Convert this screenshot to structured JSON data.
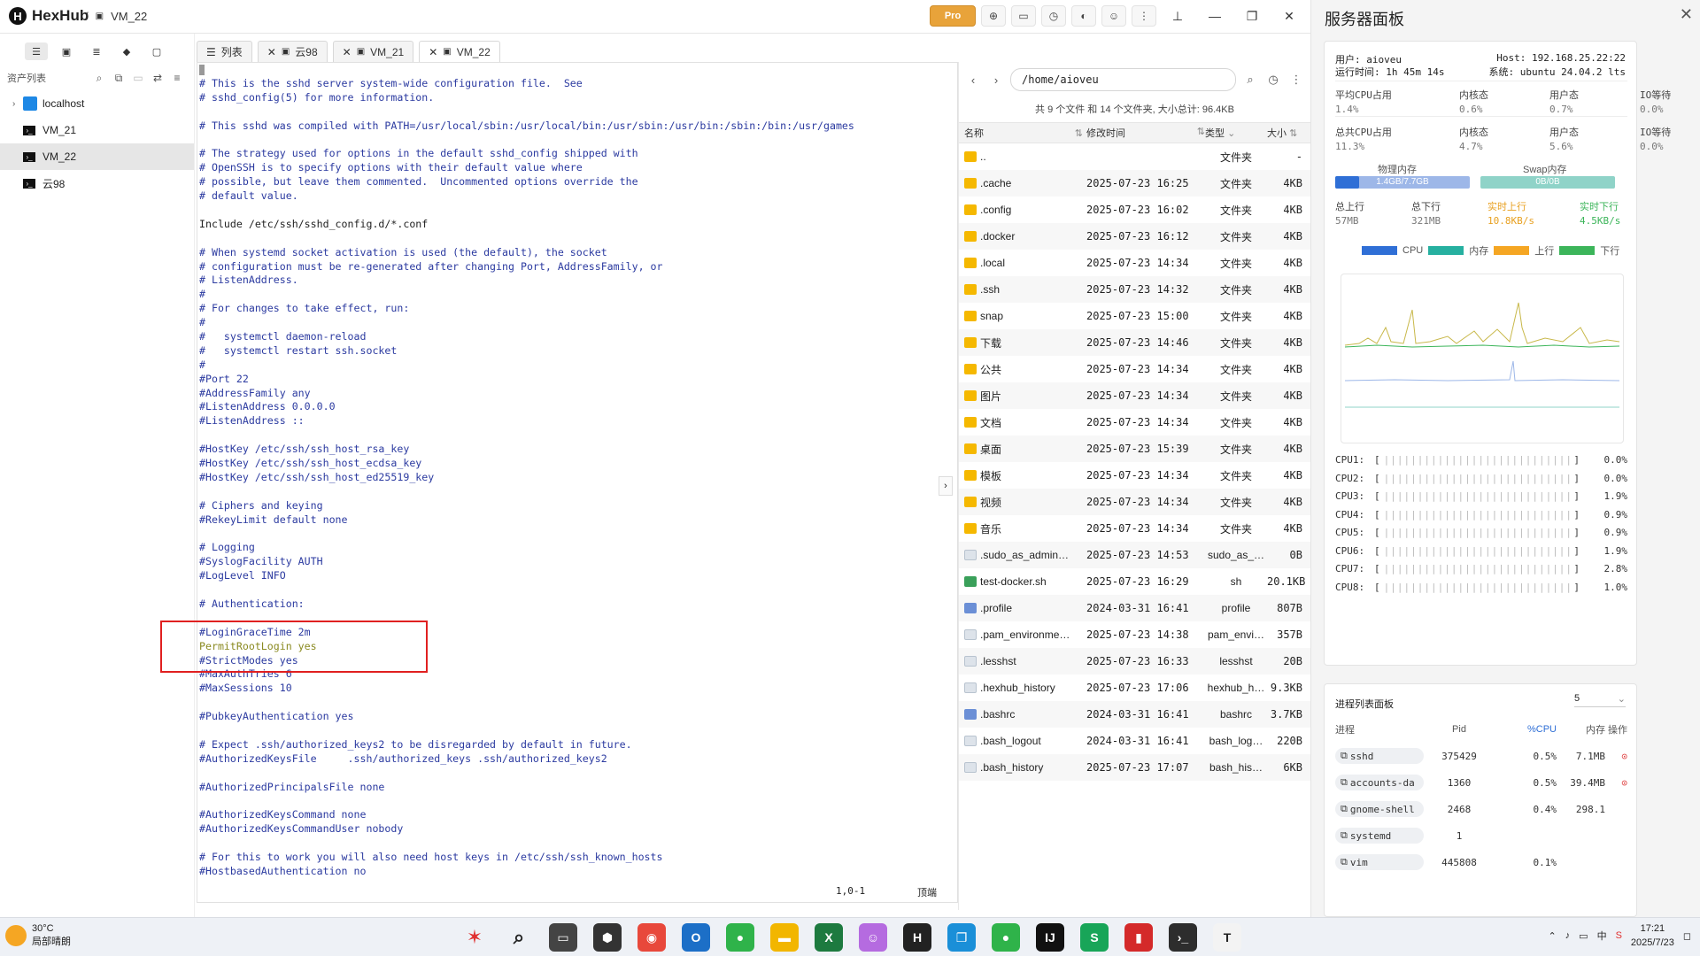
{
  "app": {
    "name": "HexHub",
    "breadcrumb_sep": "/",
    "current": "VM_22",
    "pro_label": "Pro"
  },
  "sidebar": {
    "assets_label": "资产列表",
    "items": [
      {
        "label": "localhost"
      },
      {
        "label": "VM_21"
      },
      {
        "label": "VM_22"
      },
      {
        "label": "云98"
      }
    ]
  },
  "tabs": [
    {
      "label": "列表"
    },
    {
      "label": "云98"
    },
    {
      "label": "VM_21"
    },
    {
      "label": "VM_22"
    }
  ],
  "editor": {
    "lines": [
      "# This is the sshd server system-wide configuration file.  See",
      "# sshd_config(5) for more information.",
      "",
      "# This sshd was compiled with PATH=/usr/local/sbin:/usr/local/bin:/usr/sbin:/usr/bin:/sbin:/bin:/usr/games",
      "",
      "# The strategy used for options in the default sshd_config shipped with",
      "# OpenSSH is to specify options with their default value where",
      "# possible, but leave them commented.  Uncommented options override the",
      "# default value.",
      "",
      "Include /etc/ssh/sshd_config.d/*.conf",
      "",
      "# When systemd socket activation is used (the default), the socket",
      "# configuration must be re-generated after changing Port, AddressFamily, or",
      "# ListenAddress.",
      "#",
      "# For changes to take effect, run:",
      "#",
      "#   systemctl daemon-reload",
      "#   systemctl restart ssh.socket",
      "#",
      "#Port 22",
      "#AddressFamily any",
      "#ListenAddress 0.0.0.0",
      "#ListenAddress ::",
      "",
      "#HostKey /etc/ssh/ssh_host_rsa_key",
      "#HostKey /etc/ssh/ssh_host_ecdsa_key",
      "#HostKey /etc/ssh/ssh_host_ed25519_key",
      "",
      "# Ciphers and keying",
      "#RekeyLimit default none",
      "",
      "# Logging",
      "#SyslogFacility AUTH",
      "#LogLevel INFO",
      "",
      "# Authentication:",
      "",
      "#LoginGraceTime 2m",
      "PermitRootLogin yes",
      "#StrictModes yes",
      "#MaxAuthTries 6",
      "#MaxSessions 10",
      "",
      "#PubkeyAuthentication yes",
      "",
      "# Expect .ssh/authorized_keys2 to be disregarded by default in future.",
      "#AuthorizedKeysFile     .ssh/authorized_keys .ssh/authorized_keys2",
      "",
      "#AuthorizedPrincipalsFile none",
      "",
      "#AuthorizedKeysCommand none",
      "#AuthorizedKeysCommandUser nobody",
      "",
      "# For this to work you will also need host keys in /etc/ssh/ssh_known_hosts",
      "#HostbasedAuthentication no"
    ],
    "cursor": "1,0-1",
    "position": "顶端"
  },
  "files": {
    "path": "/home/aioveu",
    "summary": "共 9 个文件 和 14 个文件夹, 大小总计: 96.4KB",
    "headers": {
      "name": "名称",
      "time": "修改时间",
      "type": "类型",
      "size": "大小"
    },
    "rows": [
      {
        "name": "..",
        "time": "",
        "type": "文件夹",
        "size": "-",
        "kind": "folder"
      },
      {
        "name": ".cache",
        "time": "2025-07-23 16:25",
        "type": "文件夹",
        "size": "4KB",
        "kind": "folder"
      },
      {
        "name": ".config",
        "time": "2025-07-23 16:02",
        "type": "文件夹",
        "size": "4KB",
        "kind": "folder"
      },
      {
        "name": ".docker",
        "time": "2025-07-23 16:12",
        "type": "文件夹",
        "size": "4KB",
        "kind": "folder"
      },
      {
        "name": ".local",
        "time": "2025-07-23 14:34",
        "type": "文件夹",
        "size": "4KB",
        "kind": "folder"
      },
      {
        "name": ".ssh",
        "time": "2025-07-23 14:32",
        "type": "文件夹",
        "size": "4KB",
        "kind": "folder"
      },
      {
        "name": "snap",
        "time": "2025-07-23 15:00",
        "type": "文件夹",
        "size": "4KB",
        "kind": "folder"
      },
      {
        "name": "下载",
        "time": "2025-07-23 14:46",
        "type": "文件夹",
        "size": "4KB",
        "kind": "folder"
      },
      {
        "name": "公共",
        "time": "2025-07-23 14:34",
        "type": "文件夹",
        "size": "4KB",
        "kind": "folder"
      },
      {
        "name": "图片",
        "time": "2025-07-23 14:34",
        "type": "文件夹",
        "size": "4KB",
        "kind": "folder"
      },
      {
        "name": "文档",
        "time": "2025-07-23 14:34",
        "type": "文件夹",
        "size": "4KB",
        "kind": "folder"
      },
      {
        "name": "桌面",
        "time": "2025-07-23 15:39",
        "type": "文件夹",
        "size": "4KB",
        "kind": "folder"
      },
      {
        "name": "模板",
        "time": "2025-07-23 14:34",
        "type": "文件夹",
        "size": "4KB",
        "kind": "folder"
      },
      {
        "name": "视频",
        "time": "2025-07-23 14:34",
        "type": "文件夹",
        "size": "4KB",
        "kind": "folder"
      },
      {
        "name": "音乐",
        "time": "2025-07-23 14:34",
        "type": "文件夹",
        "size": "4KB",
        "kind": "folder"
      },
      {
        "name": ".sudo_as_admin…",
        "time": "2025-07-23 14:53",
        "type": "sudo_as_…",
        "size": "0B",
        "kind": "file"
      },
      {
        "name": "test-docker.sh",
        "time": "2025-07-23 16:29",
        "type": "sh",
        "size": "20.1KB",
        "kind": "sh"
      },
      {
        "name": ".profile",
        "time": "2024-03-31 16:41",
        "type": "profile",
        "size": "807B",
        "kind": "cfg"
      },
      {
        "name": ".pam_environme…",
        "time": "2025-07-23 14:38",
        "type": "pam_envi…",
        "size": "357B",
        "kind": "file"
      },
      {
        "name": ".lesshst",
        "time": "2025-07-23 16:33",
        "type": "lesshst",
        "size": "20B",
        "kind": "file"
      },
      {
        "name": ".hexhub_history",
        "time": "2025-07-23 17:06",
        "type": "hexhub_h…",
        "size": "9.3KB",
        "kind": "file"
      },
      {
        "name": ".bashrc",
        "time": "2024-03-31 16:41",
        "type": "bashrc",
        "size": "3.7KB",
        "kind": "cfg"
      },
      {
        "name": ".bash_logout",
        "time": "2024-03-31 16:41",
        "type": "bash_log…",
        "size": "220B",
        "kind": "file"
      },
      {
        "name": ".bash_history",
        "time": "2025-07-23 17:07",
        "type": "bash_his…",
        "size": "6KB",
        "kind": "file"
      }
    ]
  },
  "panel": {
    "title": "服务器面板",
    "user": "用户: aioveu",
    "host": "Host: 192.168.25.22:22",
    "uptime": "运行时间: 1h 45m 14s",
    "system": "系统: ubuntu 24.04.2 lts",
    "cpu_avg": {
      "labels": [
        "平均CPU占用",
        "内核态",
        "用户态",
        "IO等待"
      ],
      "values": [
        "1.4%",
        "0.6%",
        "0.7%",
        "0.0%"
      ]
    },
    "cpu_total": {
      "labels": [
        "总共CPU占用",
        "内核态",
        "用户态",
        "IO等待"
      ],
      "values": [
        "11.3%",
        "4.7%",
        "5.6%",
        "0.0%"
      ]
    },
    "mem_label": "物理内存",
    "mem_value": "1.4GB/7.7GB",
    "mem_fraction": 0.18,
    "swap_label": "Swap内存",
    "swap_value": "0B/0B",
    "net": {
      "labels": [
        "总上行",
        "总下行",
        "实时上行",
        "实时下行"
      ],
      "values": [
        "57MB",
        "321MB",
        "10.8KB/s",
        "4.5KB/s"
      ]
    },
    "legend": [
      {
        "label": "CPU",
        "color": "#2f6fd6"
      },
      {
        "label": "内存",
        "color": "#26b0a0"
      },
      {
        "label": "上行",
        "color": "#f5a623"
      },
      {
        "label": "下行",
        "color": "#3cb55a"
      }
    ],
    "cpus": [
      {
        "label": "CPU1:",
        "value": "0.0%"
      },
      {
        "label": "CPU2:",
        "value": "0.0%"
      },
      {
        "label": "CPU3:",
        "value": "1.9%"
      },
      {
        "label": "CPU4:",
        "value": "0.9%"
      },
      {
        "label": "CPU5:",
        "value": "0.9%"
      },
      {
        "label": "CPU6:",
        "value": "1.9%"
      },
      {
        "label": "CPU7:",
        "value": "2.8%"
      },
      {
        "label": "CPU8:",
        "value": "1.0%"
      }
    ],
    "proc_title": "进程列表面板",
    "proc_count": "5",
    "proc_headers": {
      "name": "进程",
      "pid": "Pid",
      "cpu": "%CPU",
      "mem": "内存",
      "op": "操作"
    },
    "procs": [
      {
        "name": "sshd",
        "pid": "375429",
        "cpu": "0.5%",
        "mem": "7.1MB"
      },
      {
        "name": "accounts-da",
        "pid": "1360",
        "cpu": "0.5%",
        "mem": "39.4MB"
      },
      {
        "name": "gnome-shell",
        "pid": "2468",
        "cpu": "0.4%",
        "mem": "298.1"
      },
      {
        "name": "systemd",
        "pid": "1",
        "cpu": "",
        "mem": ""
      },
      {
        "name": "vim",
        "pid": "445808",
        "cpu": "0.1%",
        "mem": ""
      }
    ]
  },
  "taskbar": {
    "temp": "30°C",
    "weather": "局部晴朗",
    "time": "17:21",
    "date": "2025/7/23"
  }
}
